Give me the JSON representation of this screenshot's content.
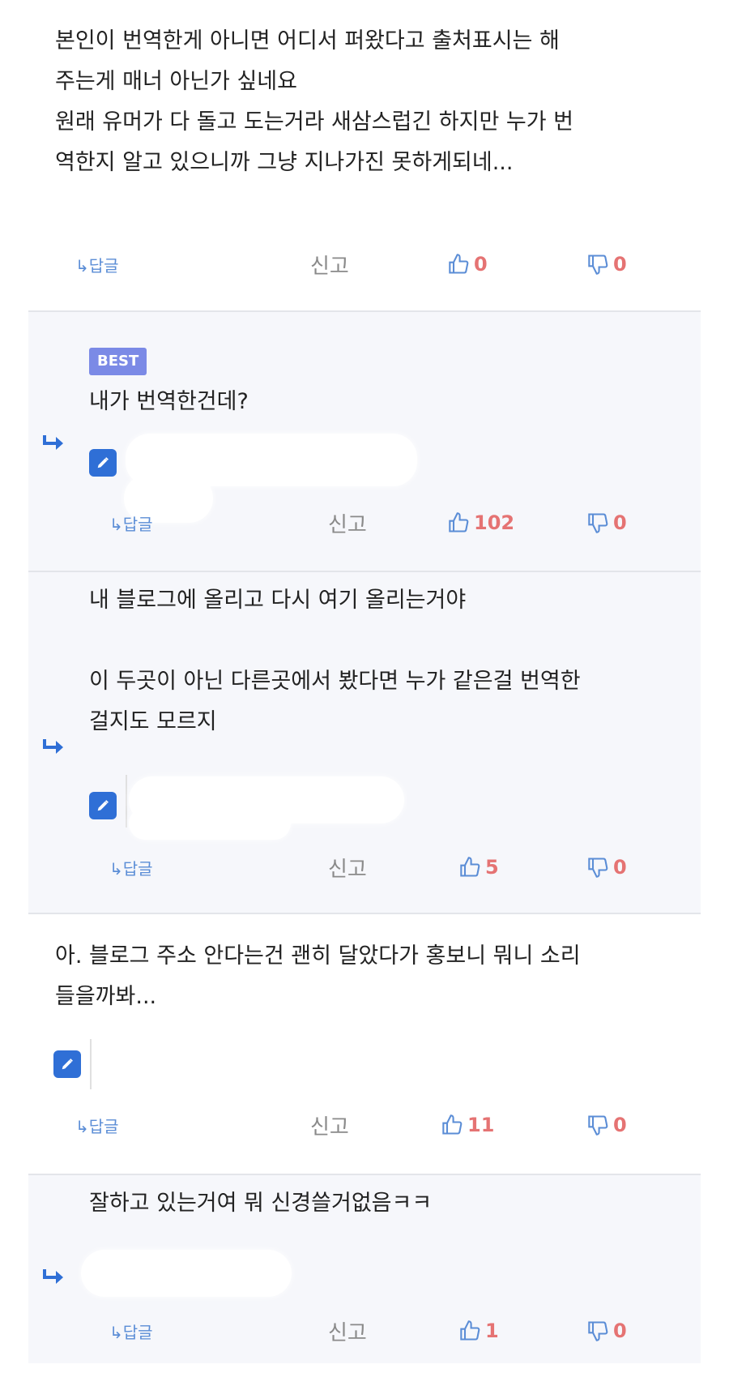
{
  "labels": {
    "reply": "↳답글",
    "report": "신고",
    "best": "BEST"
  },
  "comments": [
    {
      "text": "본인이 번역한게 아니면 어디서 퍼왔다고 출처표시는 해\n주는게 매너 아닌가 싶네요\n원래 유머가 다 돌고 도는거라 새삼스럽긴 하지만 누가 번\n역한지 알고 있으니까 그냥 지나가진 못하게되네...",
      "likes": "0",
      "dislikes": "0"
    },
    {
      "text": "내가 번역한건데?",
      "likes": "102",
      "dislikes": "0"
    },
    {
      "text": "내 블로그에 올리고 다시 여기 올리는거야\n\n이 두곳이 아닌 다른곳에서 봤다면 누가 같은걸 번역한\n걸지도 모르지",
      "likes": "5",
      "dislikes": "0"
    },
    {
      "text": "아. 블로그 주소 안다는건 괜히 달았다가 홍보니 뭐니 소리\n들을까봐...",
      "likes": "11",
      "dislikes": "0"
    },
    {
      "text": "잘하고 있는거여 뭐 신경쓸거없음ㅋㅋ",
      "likes": "1",
      "dislikes": "0"
    }
  ],
  "colors": {
    "accent": "#5b8dd6",
    "vote_count": "#e57373",
    "best_badge": "#7b8ae6",
    "edit_button": "#2f6fd6",
    "reply_bg": "#f6f7fb"
  }
}
